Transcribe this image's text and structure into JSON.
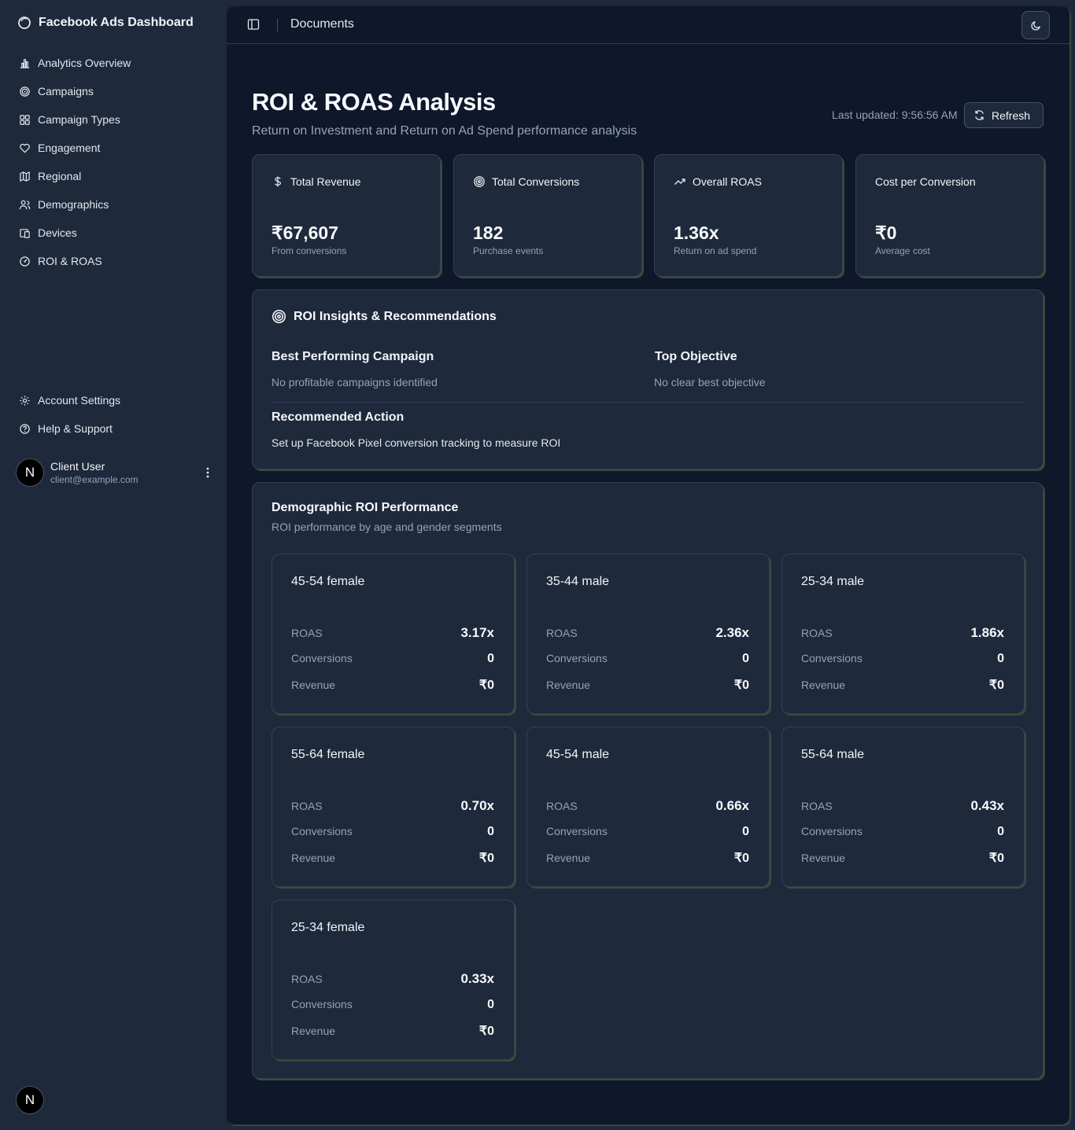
{
  "app": {
    "title": "Facebook Ads Dashboard"
  },
  "sidebar": {
    "items": [
      {
        "label": "Analytics Overview",
        "icon": "bar-chart-icon"
      },
      {
        "label": "Campaigns",
        "icon": "target-icon"
      },
      {
        "label": "Campaign Types",
        "icon": "grid-icon"
      },
      {
        "label": "Engagement",
        "icon": "heart-icon"
      },
      {
        "label": "Regional",
        "icon": "map-icon"
      },
      {
        "label": "Demographics",
        "icon": "users-icon"
      },
      {
        "label": "Devices",
        "icon": "devices-icon"
      },
      {
        "label": "ROI & ROAS",
        "icon": "gauge-icon"
      }
    ],
    "secondary": [
      {
        "label": "Account Settings",
        "icon": "gear-icon"
      },
      {
        "label": "Help & Support",
        "icon": "help-icon"
      }
    ],
    "user": {
      "initial": "N",
      "name": "Client User",
      "email": "client@example.com"
    }
  },
  "header": {
    "breadcrumb": "Documents"
  },
  "page": {
    "title": "ROI & ROAS Analysis",
    "subtitle": "Return on Investment and Return on Ad Spend performance analysis",
    "last_updated": "Last updated: 9:56:56 AM",
    "refresh_label": "Refresh"
  },
  "stats": [
    {
      "label": "Total Revenue",
      "value": "₹67,607",
      "sub": "From conversions",
      "icon": "dollar-icon"
    },
    {
      "label": "Total Conversions",
      "value": "182",
      "sub": "Purchase events",
      "icon": "target-icon"
    },
    {
      "label": "Overall ROAS",
      "value": "1.36x",
      "sub": "Return on ad spend",
      "icon": "trending-up-icon"
    },
    {
      "label": "Cost per Conversion",
      "value": "₹0",
      "sub": "Average cost",
      "icon": ""
    }
  ],
  "insights": {
    "title": "ROI Insights & Recommendations",
    "best_campaign_heading": "Best Performing Campaign",
    "best_campaign_text": "No profitable campaigns identified",
    "top_objective_heading": "Top Objective",
    "top_objective_text": "No clear best objective",
    "action_heading": "Recommended Action",
    "action_text": "Set up Facebook Pixel conversion tracking to measure ROI"
  },
  "demographics": {
    "title": "Demographic ROI Performance",
    "subtitle": "ROI performance by age and gender segments",
    "labels": {
      "roas": "ROAS",
      "conversions": "Conversions",
      "revenue": "Revenue"
    },
    "segments": [
      {
        "name": "45-54 female",
        "roas": "3.17x",
        "conversions": "0",
        "revenue": "₹0"
      },
      {
        "name": "35-44 male",
        "roas": "2.36x",
        "conversions": "0",
        "revenue": "₹0"
      },
      {
        "name": "25-34 male",
        "roas": "1.86x",
        "conversions": "0",
        "revenue": "₹0"
      },
      {
        "name": "55-64 female",
        "roas": "0.70x",
        "conversions": "0",
        "revenue": "₹0"
      },
      {
        "name": "45-54 male",
        "roas": "0.66x",
        "conversions": "0",
        "revenue": "₹0"
      },
      {
        "name": "55-64 male",
        "roas": "0.43x",
        "conversions": "0",
        "revenue": "₹0"
      },
      {
        "name": "25-34 female",
        "roas": "0.33x",
        "conversions": "0",
        "revenue": "₹0"
      }
    ]
  }
}
